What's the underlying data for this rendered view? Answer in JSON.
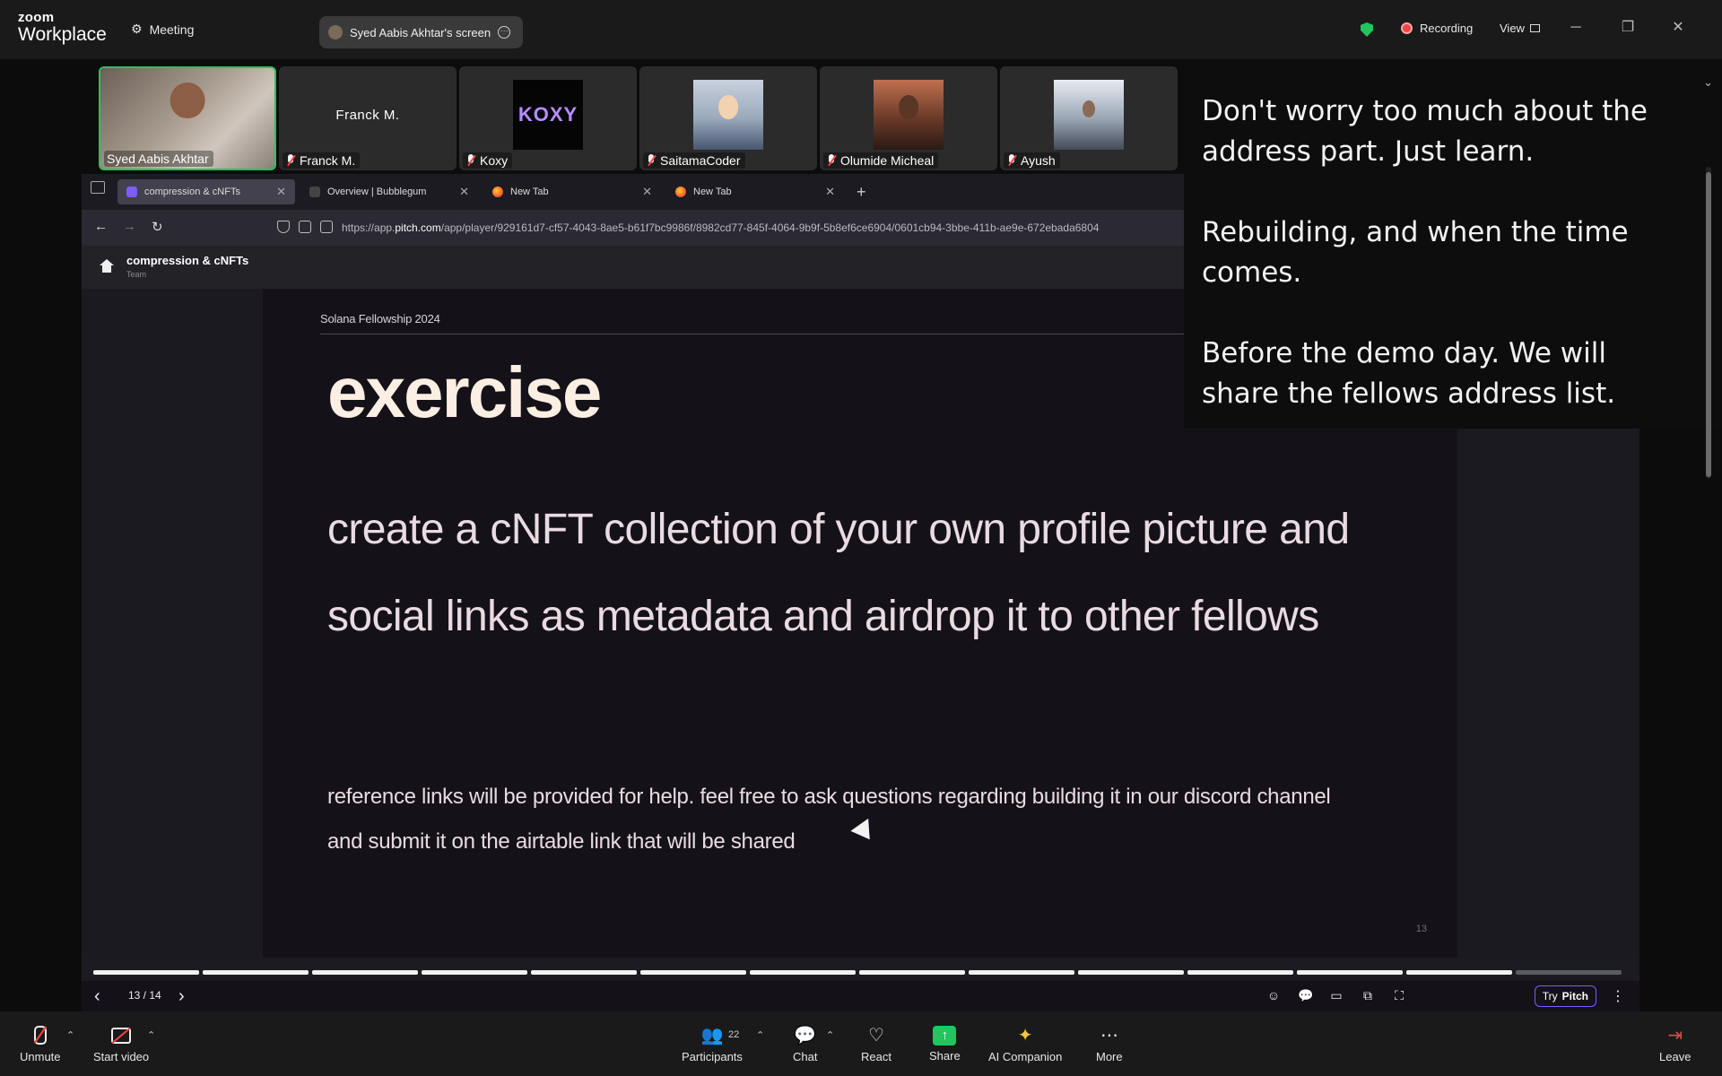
{
  "app": {
    "brand_top": "zoom",
    "brand_bottom": "Workplace",
    "meeting_label": "Meeting",
    "share_pill_label": "Syed Aabis Akhtar's screen",
    "recording_label": "Recording",
    "view_label": "View"
  },
  "participants": [
    {
      "name": "Syed Aabis Akhtar",
      "muted": false,
      "active": true,
      "thumb": "video"
    },
    {
      "name": "Franck M.",
      "muted": true,
      "active": false,
      "thumb": "name",
      "center_label": "Franck M."
    },
    {
      "name": "Koxy",
      "muted": true,
      "active": false,
      "thumb": "logo",
      "logo_text": "KOXY"
    },
    {
      "name": "SaitamaCoder",
      "muted": true,
      "active": false,
      "thumb": "avatar"
    },
    {
      "name": "Olumide Micheal",
      "muted": true,
      "active": false,
      "thumb": "avatar"
    },
    {
      "name": "Ayush",
      "muted": true,
      "active": false,
      "thumb": "avatar"
    }
  ],
  "captions": [
    "Don't worry too much about the address part. Just learn.",
    "Rebuilding, and when the time comes.",
    "Before the demo day. We will share the fellows address list."
  ],
  "browser": {
    "tabs": [
      {
        "label": "compression & cNFTs",
        "icon": "pitch-favicon",
        "active": true
      },
      {
        "label": "Overview | Bubblegum",
        "icon": "bubblegum-favicon",
        "active": false
      },
      {
        "label": "New Tab",
        "icon": "firefox-favicon",
        "active": false
      },
      {
        "label": "New Tab",
        "icon": "firefox-favicon",
        "active": false
      }
    ],
    "url_prefix": "https://app.",
    "url_domain": "pitch.com",
    "url_path": "/app/player/929161d7-cf57-4043-8ae5-b61f7bc9986f/8982cd77-845f-4064-9b9f-5b8ef6ce6904/0601cb94-3bbe-411b-ae9e-672ebada6804"
  },
  "pitch": {
    "deck_title": "compression & cNFTs",
    "deck_subtitle": "Team",
    "slide_label": "Solana Fellowship 2024",
    "slide_title": "exercise",
    "slide_body": "create a cNFT collection of your own profile picture and social links as metadata and airdrop it to other fellows",
    "slide_note": "reference links will be provided for help. feel free to ask questions regarding building it in our discord channel and submit it on the airtable link that will be shared",
    "slide_number": "13",
    "page_indicator": "13 / 14",
    "current_slide": 13,
    "total_slides": 14,
    "try_label": "Try",
    "pitch_label": "Pitch"
  },
  "toolbar": {
    "unmute": "Unmute",
    "start_video": "Start video",
    "participants": "Participants",
    "participants_count": "22",
    "chat": "Chat",
    "react": "React",
    "share": "Share",
    "ai_companion": "AI Companion",
    "more": "More",
    "leave": "Leave"
  },
  "colors": {
    "accent_green": "#22c55e",
    "recording_red": "#ef4444",
    "pitch_purple": "#7b5cff",
    "slide_title": "#fbeee3"
  }
}
